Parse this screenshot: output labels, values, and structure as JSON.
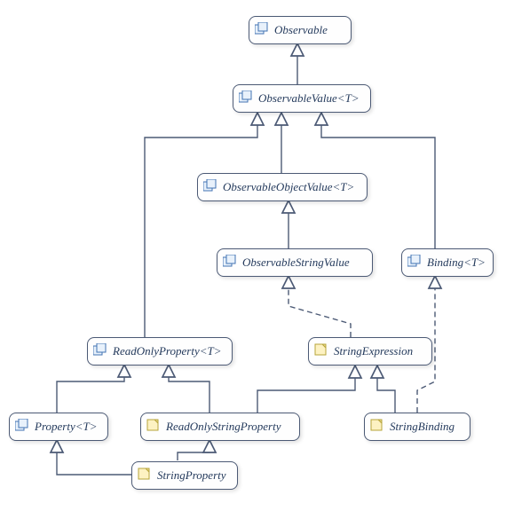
{
  "nodes": {
    "observable": {
      "label": "Observable",
      "stereotype": "interface"
    },
    "observableValue": {
      "label": "ObservableValue<T>",
      "stereotype": "interface"
    },
    "observableObjectValue": {
      "label": "ObservableObjectValue<T>",
      "stereotype": "interface"
    },
    "observableStringValue": {
      "label": "ObservableStringValue",
      "stereotype": "interface"
    },
    "binding": {
      "label": "Binding<T>",
      "stereotype": "interface"
    },
    "readOnlyProperty": {
      "label": "ReadOnlyProperty<T>",
      "stereotype": "interface"
    },
    "stringExpression": {
      "label": "StringExpression",
      "stereotype": "class"
    },
    "property": {
      "label": "Property<T>",
      "stereotype": "interface"
    },
    "readOnlyStringProperty": {
      "label": "ReadOnlyStringProperty",
      "stereotype": "class"
    },
    "stringBinding": {
      "label": "StringBinding",
      "stereotype": "class"
    },
    "stringProperty": {
      "label": "StringProperty",
      "stereotype": "class"
    }
  },
  "edges": [
    {
      "from": "observableValue",
      "to": "observable",
      "style": "solid"
    },
    {
      "from": "observableObjectValue",
      "to": "observableValue",
      "style": "solid"
    },
    {
      "from": "readOnlyProperty",
      "to": "observableValue",
      "style": "solid"
    },
    {
      "from": "binding",
      "to": "observableValue",
      "style": "solid"
    },
    {
      "from": "observableStringValue",
      "to": "observableObjectValue",
      "style": "solid"
    },
    {
      "from": "readOnlyStringProperty",
      "to": "readOnlyProperty",
      "style": "solid"
    },
    {
      "from": "property",
      "to": "readOnlyProperty",
      "style": "solid"
    },
    {
      "from": "stringProperty",
      "to": "property",
      "style": "solid"
    },
    {
      "from": "stringProperty",
      "to": "readOnlyStringProperty",
      "style": "solid"
    },
    {
      "from": "readOnlyStringProperty",
      "to": "stringExpression",
      "style": "solid"
    },
    {
      "from": "stringBinding",
      "to": "stringExpression",
      "style": "solid"
    },
    {
      "from": "stringExpression",
      "to": "observableStringValue",
      "style": "dashed"
    },
    {
      "from": "stringBinding",
      "to": "binding",
      "style": "dashed"
    }
  ]
}
